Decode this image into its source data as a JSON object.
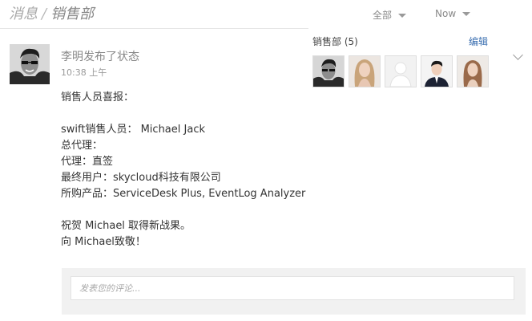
{
  "breadcrumb": {
    "parent": "消息",
    "separator": "/",
    "current": "销售部"
  },
  "filters": {
    "scope": "全部",
    "sort": "Now"
  },
  "post": {
    "author_action": "李明发布了状态",
    "time": "10:38 上午",
    "lines": [
      "销售人员喜报：",
      "",
      "swift销售人员： Michael Jack",
      "总代理：",
      "代理：直签",
      "最终用户：skycloud科技有限公司",
      "所购产品：ServiceDesk Plus, EventLog Analyzer",
      "",
      "祝贺 Michael 取得新战果。",
      "向 Michael致敬！"
    ]
  },
  "comment": {
    "placeholder": "发表您的评论..."
  },
  "group": {
    "title": "销售部 (5)",
    "edit_label": "编辑",
    "members": [
      {
        "avatar": "man-sunglasses"
      },
      {
        "avatar": "woman-blonde"
      },
      {
        "avatar": "default-silhouette"
      },
      {
        "avatar": "man-suit"
      },
      {
        "avatar": "woman-brunette"
      }
    ]
  },
  "icons": {
    "dropdown": "caret-down-icon",
    "expand": "chevron-down-icon"
  }
}
